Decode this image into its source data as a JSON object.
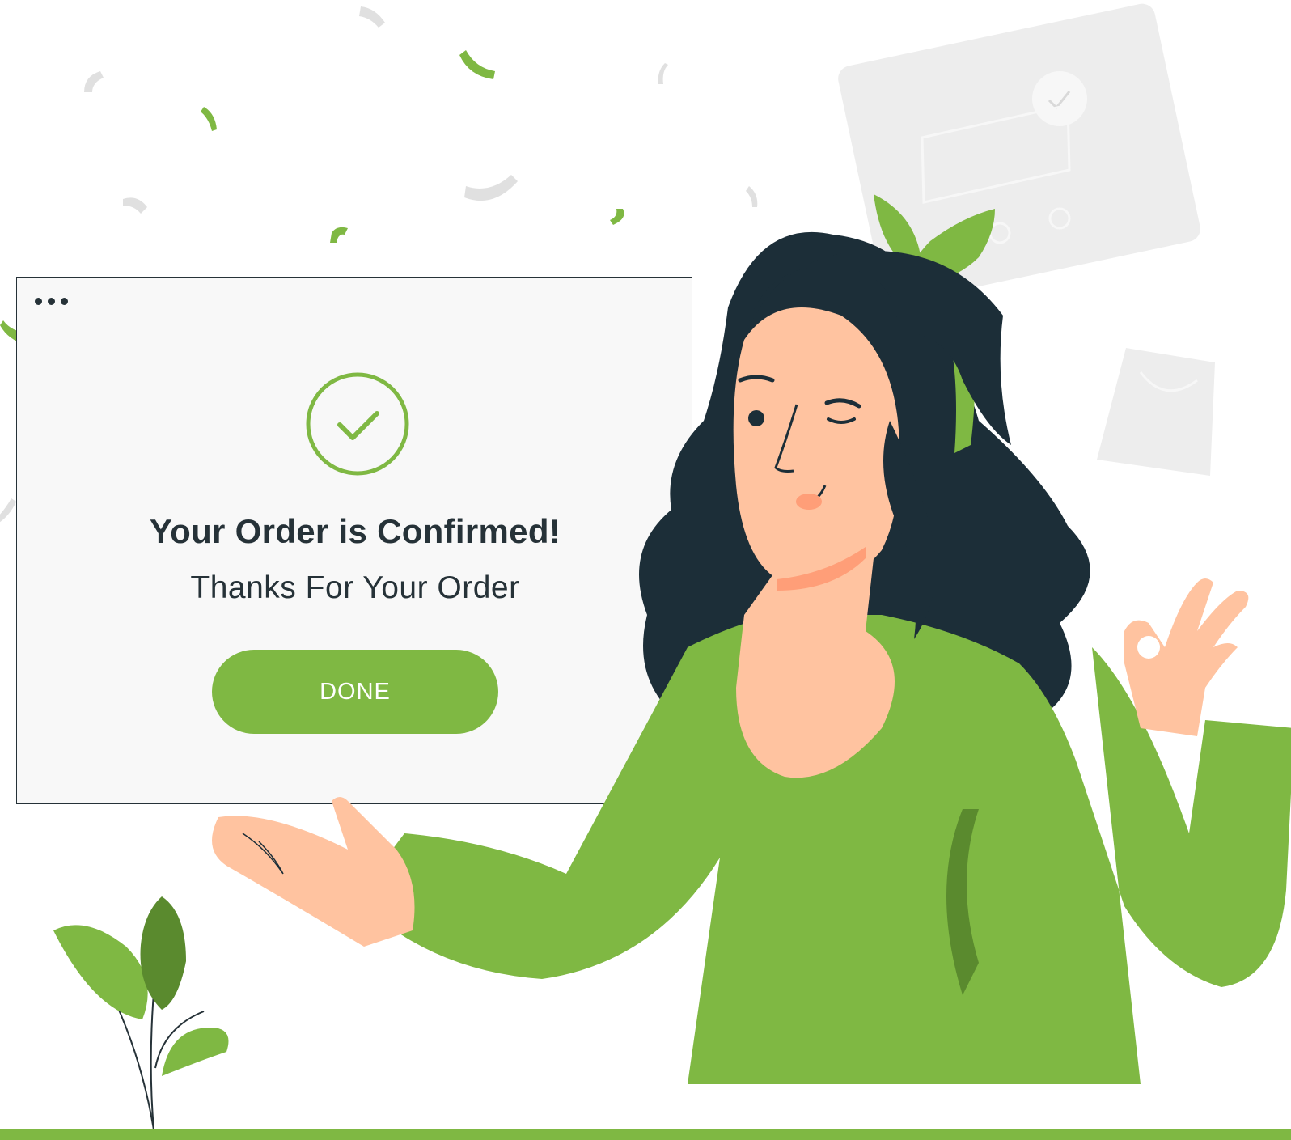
{
  "dialog": {
    "title": "Your Order is Confirmed!",
    "subtitle": "Thanks For Your Order",
    "done_label": "DONE"
  },
  "icons": {
    "window_menu": "more-dots-icon",
    "status": "checkmark-circle-icon"
  },
  "colors": {
    "accent": "#7fb843",
    "dark": "#263238",
    "skin": "#ffc3a0",
    "hair": "#1c2e38",
    "confetti_gray": "#e0e0e0",
    "window_bg": "#f8f8f8"
  }
}
